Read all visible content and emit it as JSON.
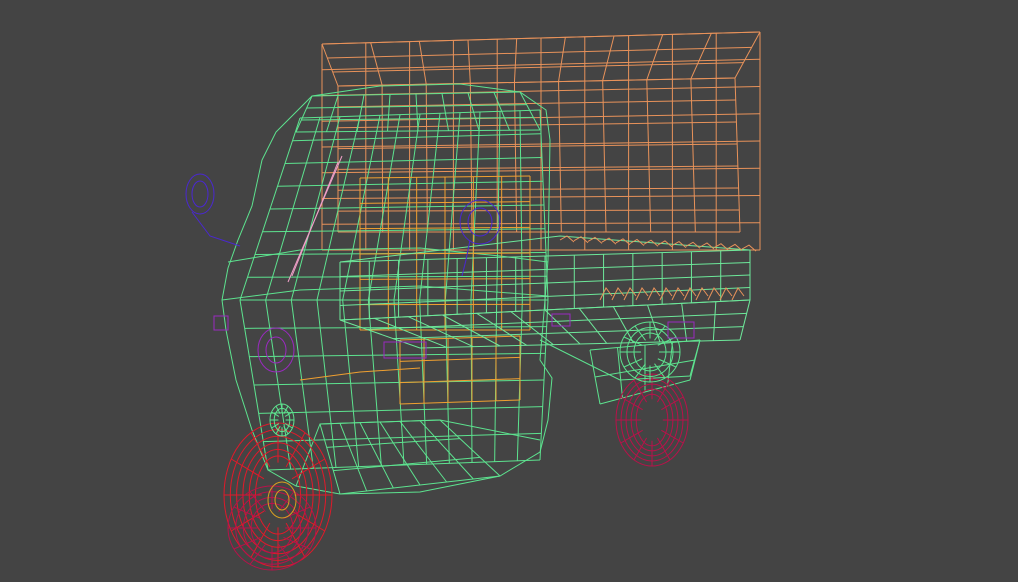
{
  "viewport": {
    "background": "#444444",
    "render_mode": "wireframe",
    "model": "three-wheeler-cargo-vehicle"
  },
  "colors": {
    "cargo_canopy": "#e8925a",
    "cab_body": "#5de38f",
    "cargo_bed": "#6de89a",
    "front_wheel": "#e01a2a",
    "rear_wheel": "#b8124a",
    "mirror": "#4a28d0",
    "lights": "#9a2ac0",
    "wiper": "#f0a0c8",
    "engine": "#d9a020",
    "interior": "#f0a030"
  }
}
